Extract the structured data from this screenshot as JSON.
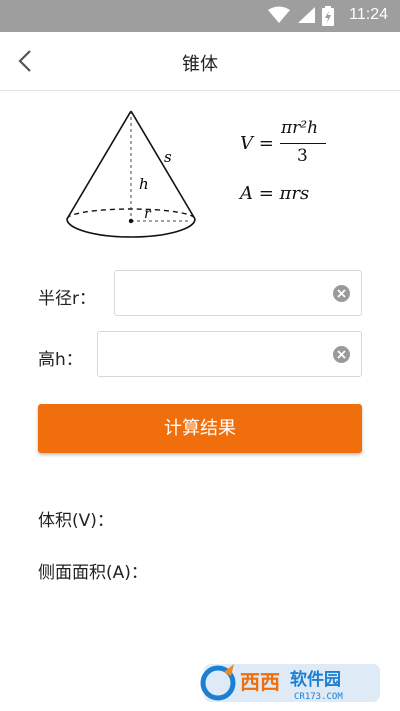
{
  "status_bar": {
    "time": "11:24",
    "icons": [
      "wifi-icon",
      "signal-icon",
      "battery-charging-icon"
    ]
  },
  "app_bar": {
    "title": "锥体",
    "back_icon": "chevron-left-icon"
  },
  "formulas": {
    "volume": {
      "lhs": "V =",
      "numerator": "πr²h",
      "denominator": "3"
    },
    "area": {
      "text": "A = πrs"
    },
    "figure_labels": {
      "slant": "s",
      "height": "h",
      "radius": "r"
    }
  },
  "form": {
    "radius_label": "半径r：",
    "radius_value": "",
    "height_label": "高h：",
    "height_value": "",
    "clear_icon": "clear-icon"
  },
  "calculate_button": "计算结果",
  "results": {
    "volume_label": "体积(V)：",
    "area_label": "侧面面积(A)："
  },
  "watermark": {
    "text": "西西软件园",
    "url_text": "CR173.COM"
  },
  "colors": {
    "accent": "#f06f0c",
    "statusbar": "#9e9e9e"
  }
}
